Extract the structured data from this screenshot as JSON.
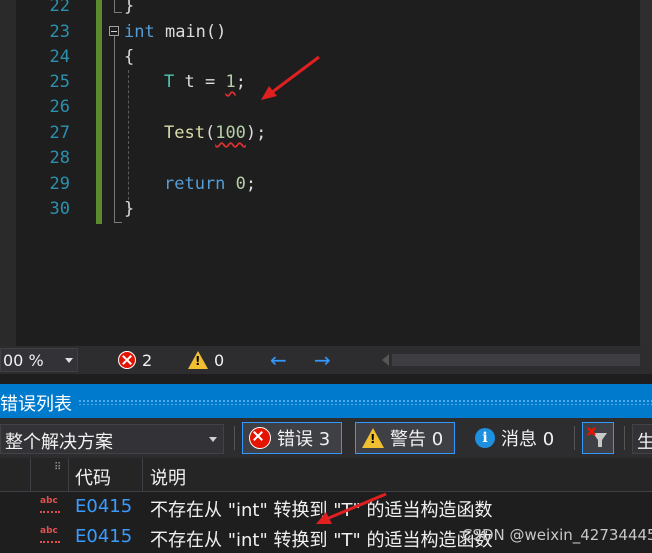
{
  "editor": {
    "lines": [
      {
        "num": "22",
        "text": "}"
      },
      {
        "num": "23",
        "kw": "int",
        "rest": " main()"
      },
      {
        "num": "24",
        "text": "{"
      },
      {
        "num": "25",
        "type": "T",
        "mid": " t = ",
        "val": "1",
        "end": ";"
      },
      {
        "num": "26",
        "text": ""
      },
      {
        "num": "27",
        "fn": "Test",
        "open": "(",
        "arg": "100",
        "close": ");"
      },
      {
        "num": "28",
        "text": ""
      },
      {
        "num": "29",
        "kw": "return",
        "rest": " ",
        "val": "0",
        "end": ";"
      },
      {
        "num": "30",
        "text": "}"
      }
    ]
  },
  "status": {
    "zoom": "00 %",
    "errors": "2",
    "warnings": "0",
    "back_arrow": "←",
    "forward_arrow": "→"
  },
  "panel": {
    "title": "错误列表",
    "scope": "整个解决方案",
    "errors_btn": "错误 3",
    "warnings_btn": "警告 0",
    "messages_btn": "消息 0",
    "last_btn": "生",
    "columns": {
      "code": "代码",
      "desc": "说明"
    },
    "rows": [
      {
        "icon": "abc",
        "code": "E0415",
        "desc": "不存在从 \"int\" 转换到 \"T\" 的适当构造函数"
      },
      {
        "icon": "abc",
        "code": "E0415",
        "desc": "不存在从 \"int\" 转换到 \"T\" 的适当构造函数"
      }
    ]
  },
  "watermark": "CSDN @weixin_42734445",
  "colors": {
    "accent": "#007acc",
    "error": "#e51400",
    "keyword": "#569cd6",
    "type": "#4ec9b0",
    "function": "#dcdcaa",
    "number": "#b5cea8",
    "annotation_arrow": "#e02020"
  }
}
